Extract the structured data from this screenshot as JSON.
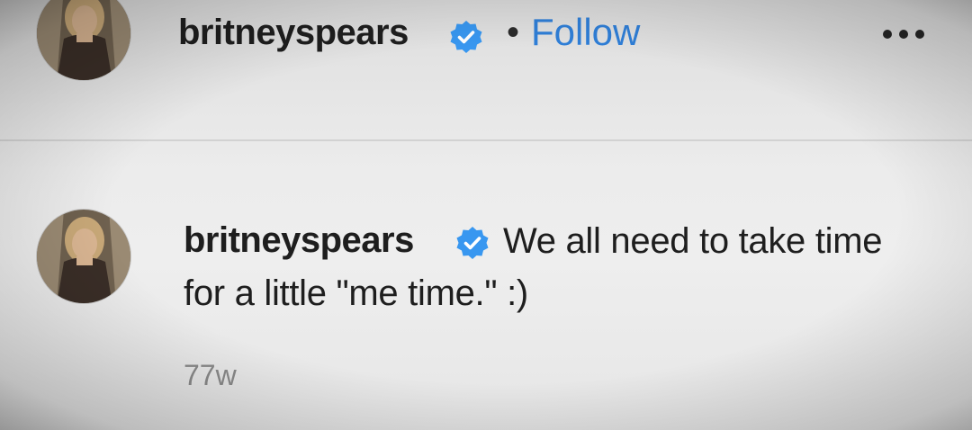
{
  "header": {
    "username": "britneyspears",
    "verified_icon": "verified-badge-icon",
    "separator": "•",
    "follow_label": "Follow",
    "more_icon": "more-options-icon"
  },
  "post": {
    "caption_username": "britneyspears",
    "caption_line1": "We all need to take time",
    "caption_line2": "for a little \"me time.\" :)",
    "timestamp": "77w"
  },
  "colors": {
    "link_blue": "#2f7fd8",
    "verified_blue": "#3897f0",
    "text": "#1e1e1e",
    "muted": "#8a8a8a"
  }
}
